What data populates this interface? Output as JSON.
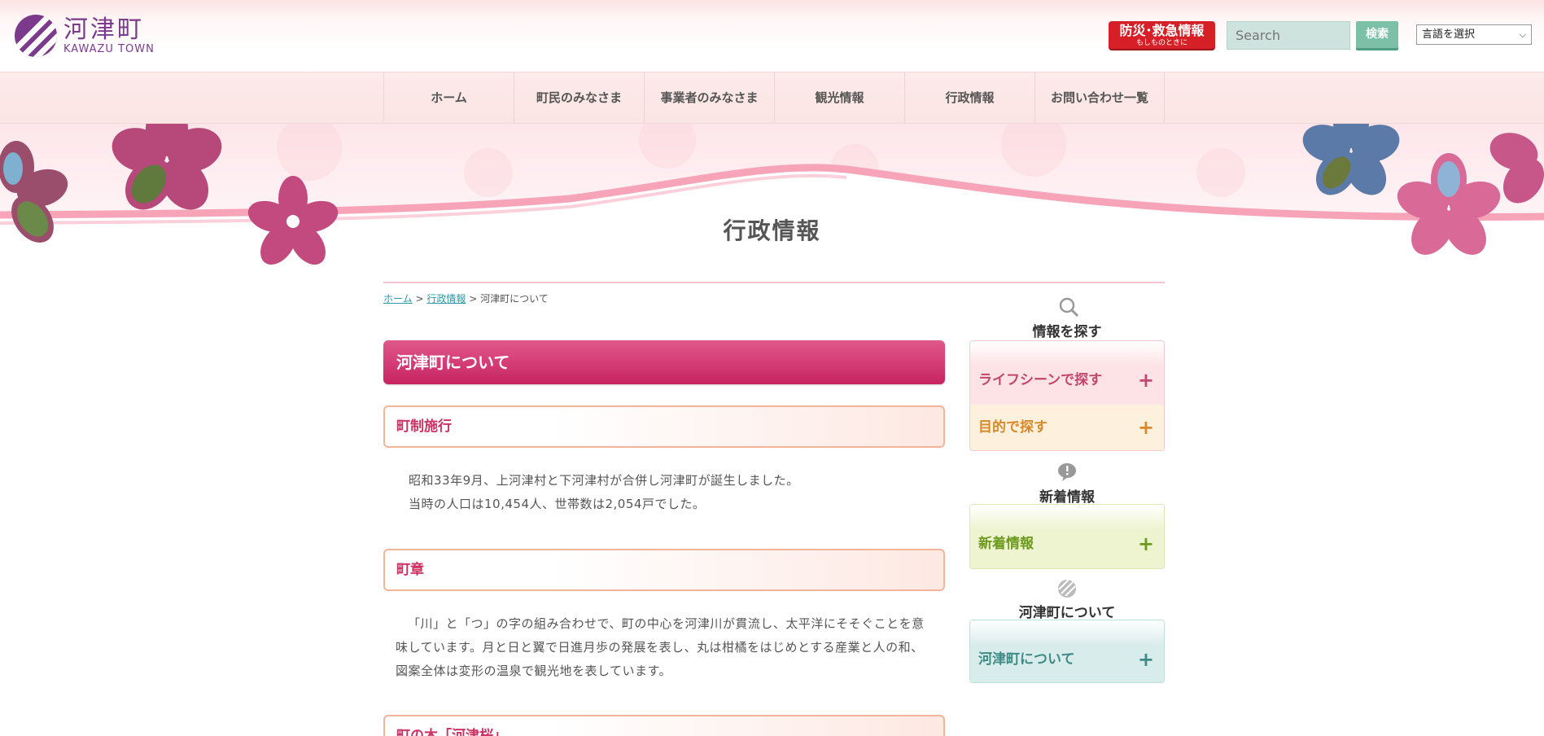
{
  "header": {
    "logo_jp": "河津町",
    "logo_en": "KAWAZU TOWN",
    "emergency_main": "防災･救急情報",
    "emergency_sub": "もしものときに",
    "search_placeholder": "Search",
    "search_button": "検索",
    "language_select": "言語を選択"
  },
  "nav": {
    "items": [
      "ホーム",
      "町民のみなさま",
      "事業者のみなさま",
      "観光情報",
      "行政情報",
      "お問い合わせ一覧"
    ]
  },
  "hero": {
    "title": "行政情報"
  },
  "breadcrumb": {
    "home": "ホーム",
    "sep": ">",
    "section": "行政情報",
    "current": "河津町について"
  },
  "main": {
    "heading": "河津町について",
    "sections": [
      {
        "title": "町制施行",
        "lines": [
          "昭和33年9月、上河津村と下河津村が合併し河津町が誕生しました。",
          "当時の人口は10,454人、世帯数は2,054戸でした。"
        ]
      },
      {
        "title": "町章",
        "lines": [
          "「川」と「つ」の字の組み合わせで、町の中心を河津川が貫流し、太平洋にそそぐことを意味しています。月と日と翼で日進月歩の発展を表し、丸は柑橘をはじめとする産業と人の和、図案全体は変形の温泉で観光地を表しています。"
        ]
      },
      {
        "title": "町の木「河津桜」"
      }
    ]
  },
  "sidebar": {
    "find_title": "情報を探す",
    "find_items": [
      "ライフシーンで探す",
      "目的で探す"
    ],
    "news_title": "新着情報",
    "news_item": "新着情報",
    "about_title": "河津町について",
    "about_item": "河津町について",
    "plus": "+"
  },
  "colors": {
    "accent_pink": "#cc3363",
    "heading_gradient_top": "#e0588a",
    "emergency_red": "#d61f26",
    "search_green": "#7cc0a8",
    "logo_purple": "#7b3a8c"
  },
  "icons": [
    "magnifier-icon",
    "info-bubble-icon",
    "kawazu-logo-icon",
    "plus-icon",
    "chevron-down-icon"
  ]
}
